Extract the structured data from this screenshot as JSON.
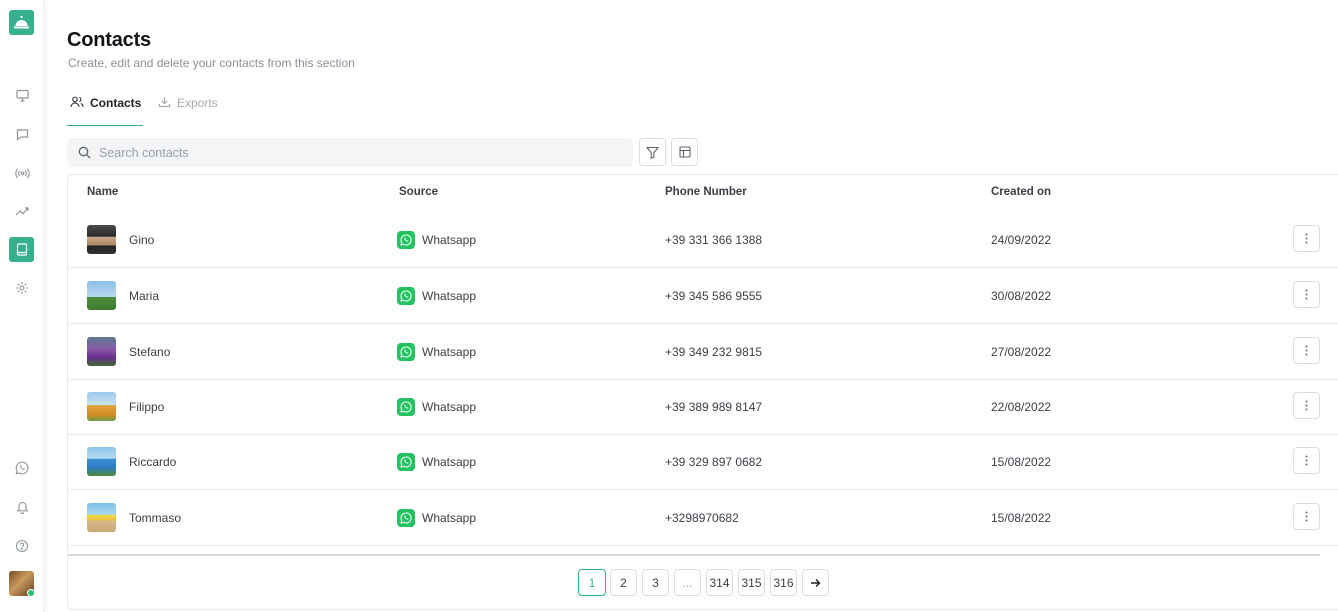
{
  "app": {
    "accent": "#36b08d",
    "whatsapp_color": "#25c262"
  },
  "sidebar": {
    "logo_icon": "service-bell-icon",
    "items": [
      {
        "name": "monitor-icon",
        "active": false
      },
      {
        "name": "chat-icon",
        "active": false
      },
      {
        "name": "broadcast-icon",
        "active": false
      },
      {
        "name": "analytics-icon",
        "active": false
      },
      {
        "name": "contacts-book-icon",
        "active": true
      },
      {
        "name": "gear-icon",
        "active": false
      }
    ],
    "bottom_items": [
      "whatsapp-icon",
      "bell-icon",
      "help-icon"
    ],
    "user_status": "online"
  },
  "header": {
    "title": "Contacts",
    "subtitle": "Create, edit and delete your contacts from this section"
  },
  "tabs": [
    {
      "label": "Contacts",
      "icon": "users-icon",
      "active": true
    },
    {
      "label": "Exports",
      "icon": "download-icon",
      "active": false
    }
  ],
  "search": {
    "placeholder": "Search contacts",
    "value": ""
  },
  "table": {
    "columns": [
      "Name",
      "Source",
      "Phone Number",
      "Created on"
    ],
    "rows": [
      {
        "name": "Gino",
        "source": "Whatsapp",
        "phone": "+39 331 366 1388",
        "created": "24/09/2022"
      },
      {
        "name": "Maria",
        "source": "Whatsapp",
        "phone": "+39 345 586 9555",
        "created": "30/08/2022"
      },
      {
        "name": "Stefano",
        "source": "Whatsapp",
        "phone": "+39 349 232 9815",
        "created": "27/08/2022"
      },
      {
        "name": "Filippo",
        "source": "Whatsapp",
        "phone": "+39 389 989 8147",
        "created": "22/08/2022"
      },
      {
        "name": "Riccardo",
        "source": "Whatsapp",
        "phone": "+39 329 897 0682",
        "created": "15/08/2022"
      },
      {
        "name": "Tommaso",
        "source": "Whatsapp",
        "phone": "+3298970682",
        "created": "15/08/2022"
      }
    ]
  },
  "pagination": {
    "pages": [
      "1",
      "2",
      "3",
      "...",
      "314",
      "315",
      "316"
    ],
    "current": "1",
    "next_icon": "arrow-right-icon"
  }
}
